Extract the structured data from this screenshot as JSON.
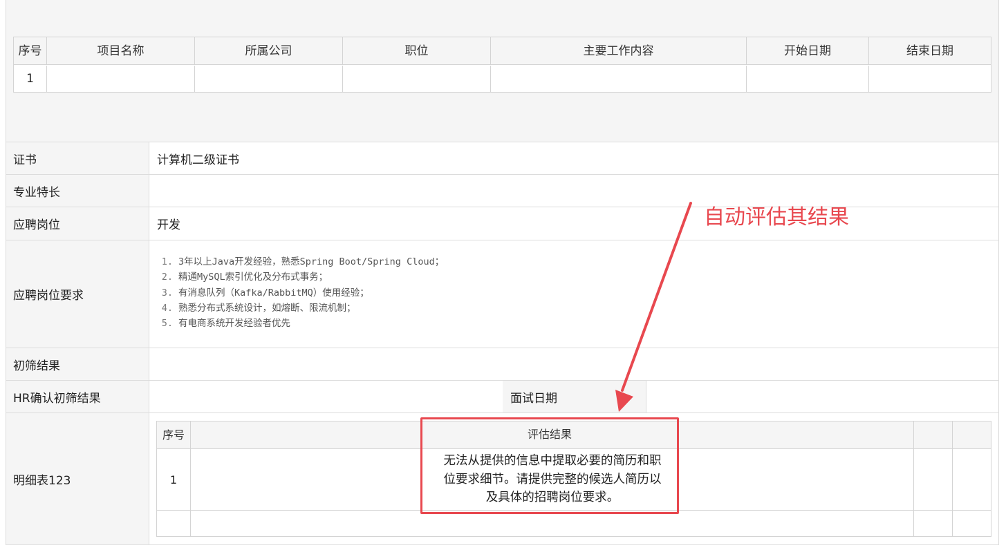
{
  "experience_table": {
    "headers": [
      "序号",
      "项目名称",
      "所属公司",
      "职位",
      "主要工作内容",
      "开始日期",
      "结束日期"
    ],
    "rows": [
      [
        "1",
        "",
        "",
        "",
        "",
        "",
        ""
      ]
    ]
  },
  "form": {
    "certificate": {
      "label": "证书",
      "value": "计算机二级证书"
    },
    "specialty": {
      "label": "专业特长",
      "value": ""
    },
    "position": {
      "label": "应聘岗位",
      "value": "开发"
    },
    "requirements": {
      "label": "应聘岗位要求",
      "items": [
        {
          "num": "1.",
          "text": "3年以上Java开发经验，熟悉Spring Boot/Spring Cloud；"
        },
        {
          "num": "2.",
          "text": "精通MySQL索引优化及分布式事务；"
        },
        {
          "num": "3.",
          "text": "有消息队列（Kafka/RabbitMQ）使用经验；"
        },
        {
          "num": "4.",
          "text": "熟悉分布式系统设计，如熔断、限流机制；"
        },
        {
          "num": "5.",
          "text": "有电商系统开发经验者优先"
        }
      ]
    },
    "screening_result": {
      "label": "初筛结果",
      "value": ""
    },
    "hr_confirm": {
      "label": "HR确认初筛结果",
      "value": "",
      "interview_label": "面试日期",
      "interview_value": ""
    },
    "detail": {
      "label": "明细表123",
      "headers": [
        "序号",
        "评估结果"
      ],
      "rows": [
        {
          "index": "1",
          "result": "无法从提供的信息中提取必要的简历和职位要求细节。请提供完整的候选人简历以及具体的招聘岗位要求。"
        }
      ]
    }
  },
  "annotation": {
    "label": "自动评估其结果",
    "color": "#e8484f"
  }
}
